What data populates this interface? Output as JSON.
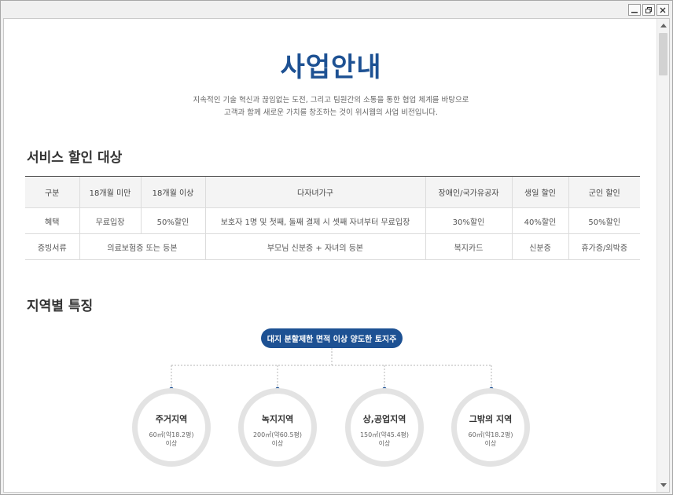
{
  "title": "사업안내",
  "intro": {
    "line1": "지속적인 기술 혁신과 끊임없는 도전, 그리고 팀원간의 소통을 통한 협업 체계를 바탕으로",
    "line2": "고객과 함께 새로운 가치를 창조하는 것이 위시웹의 사업 비전입니다."
  },
  "discount_section": {
    "heading": "서비스 할인 대상",
    "columns": [
      "구분",
      "18개월 미만",
      "18개월 이상",
      "다자녀가구",
      "장애인/국가유공자",
      "생일 할인",
      "군인 할인"
    ],
    "benefit_row": [
      "혜택",
      "무료입장",
      "50%할인",
      "보호자 1명 및 첫째, 둘째 결제 시 셋째 자녀부터 무료입장",
      "30%할인",
      "40%할인",
      "50%할인"
    ],
    "document_row": {
      "label": "증빙서류",
      "infant": "의료보험증 또는 등본",
      "family": "부모님 신분증 + 자녀의 등본",
      "disabled": "복지카드",
      "birthday": "신분증",
      "military": "휴가증/외박증"
    }
  },
  "region_section": {
    "heading": "지역별 특징",
    "root_label": "대지 분할제한 면적 이상 양도한 토지주",
    "regions": [
      {
        "name": "주거지역",
        "area": "60㎡(약18.2평)",
        "note": "이상"
      },
      {
        "name": "녹지지역",
        "area": "200㎡(약60.5평)",
        "note": "이상"
      },
      {
        "name": "상,공업지역",
        "area": "150㎡(약45.4평)",
        "note": "이상"
      },
      {
        "name": "그밖의 지역",
        "area": "60㎡(약18.2평)",
        "note": "이상"
      }
    ]
  },
  "colors": {
    "accent": "#1d5193",
    "circle_border": "#e3e3e3",
    "table_header_bg": "#f4f4f4"
  },
  "icons": {
    "minimize": "minimize-icon",
    "restore": "restore-icon",
    "scroll_up": "triangle-up-icon",
    "scroll_down": "triangle-down-icon"
  }
}
